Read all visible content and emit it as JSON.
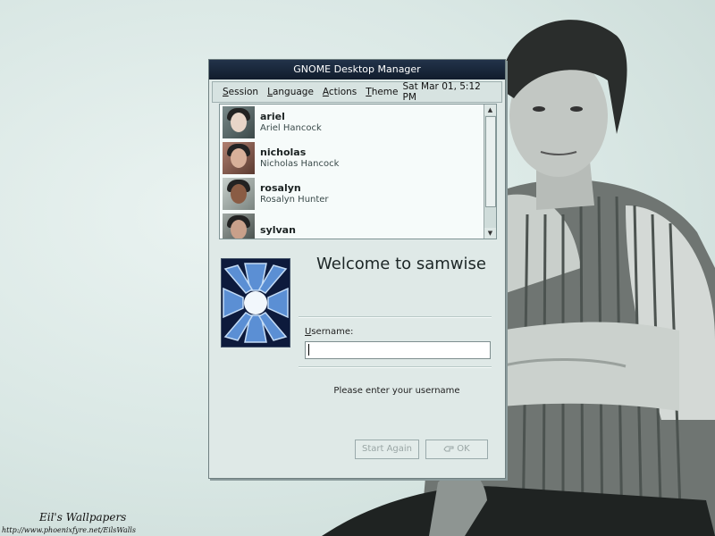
{
  "window": {
    "title": "GNOME Desktop Manager"
  },
  "menubar": {
    "items": [
      {
        "mnemonic": "S",
        "rest": "ession"
      },
      {
        "mnemonic": "L",
        "rest": "anguage"
      },
      {
        "mnemonic": "A",
        "rest": "ctions"
      },
      {
        "mnemonic": "T",
        "rest": "heme"
      }
    ],
    "clock": "Sat Mar 01,  5:12 PM"
  },
  "users": [
    {
      "login": "ariel",
      "name": "Ariel Hancock"
    },
    {
      "login": "nicholas",
      "name": "Nicholas Hancock"
    },
    {
      "login": "rosalyn",
      "name": "Rosalyn Hunter"
    },
    {
      "login": "sylvan",
      "name": ""
    }
  ],
  "welcome": "Welcome to samwise",
  "login": {
    "username_mnemonic": "U",
    "username_rest": "sername:",
    "username_value": "",
    "prompt": "Please enter your username"
  },
  "buttons": {
    "start_again": "Start Again",
    "ok": "OK"
  },
  "wallpaper": {
    "title": "Eil's Wallpapers",
    "url": "http://www.phoenixfyre.net/EilsWalls"
  },
  "colors": {
    "titlebar": "#1a2a40",
    "dialog": "#dfe9e7",
    "logo_bg": "#0d1a3c"
  }
}
